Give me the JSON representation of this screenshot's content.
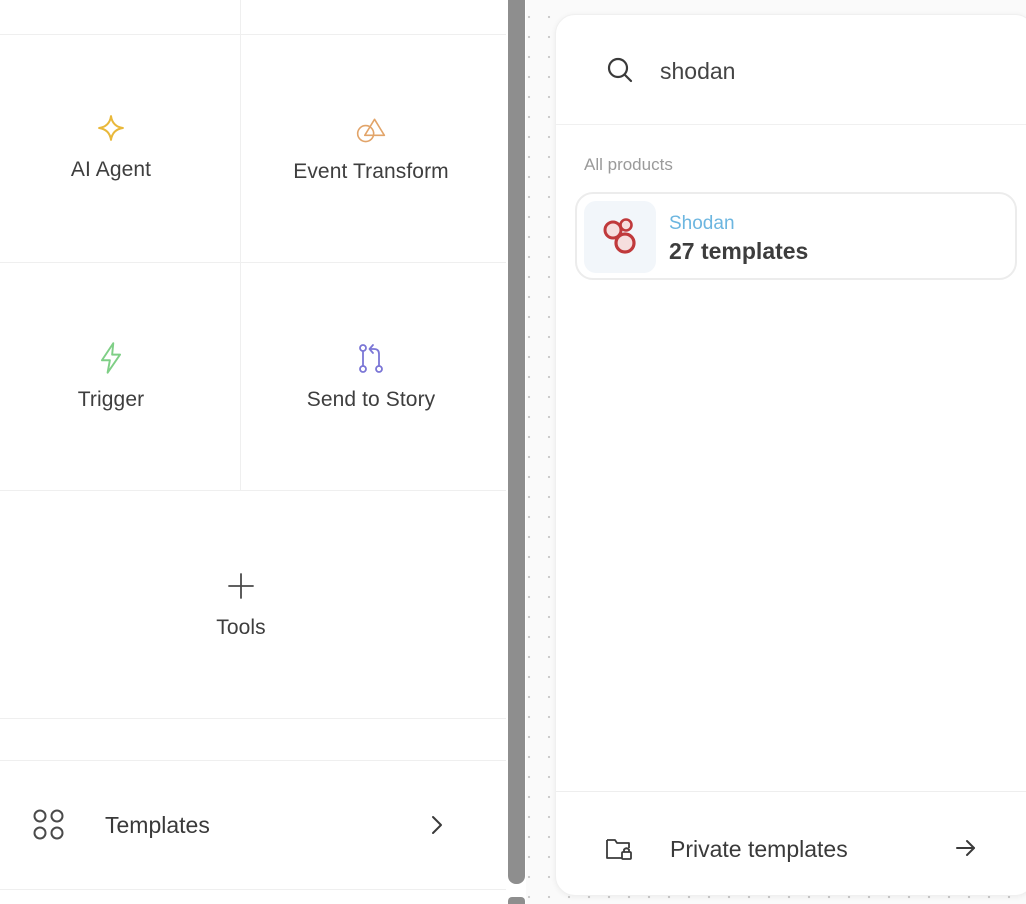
{
  "palette": {
    "tiles": [
      {
        "label": "AI Agent",
        "icon": "sparkle-icon",
        "color": "#e9b83a"
      },
      {
        "label": "Event Transform",
        "icon": "shapes-icon",
        "color": "#e2a469"
      },
      {
        "label": "Trigger",
        "icon": "lightning-icon",
        "color": "#7fcf86"
      },
      {
        "label": "Send to Story",
        "icon": "git-branch-icon",
        "color": "#7b76d6"
      },
      {
        "label": "Tools",
        "icon": "plus-icon",
        "color": "#4a4a4a"
      }
    ],
    "templates": {
      "label": "Templates",
      "icon": "grid-circles-icon"
    }
  },
  "search": {
    "query": "shodan",
    "section_label": "All products",
    "results": [
      {
        "name": "Shodan",
        "count_label": "27 templates",
        "name_color": "#6cb6e0",
        "logo_color": "#c0393b"
      }
    ]
  },
  "footer": {
    "label": "Private templates"
  }
}
